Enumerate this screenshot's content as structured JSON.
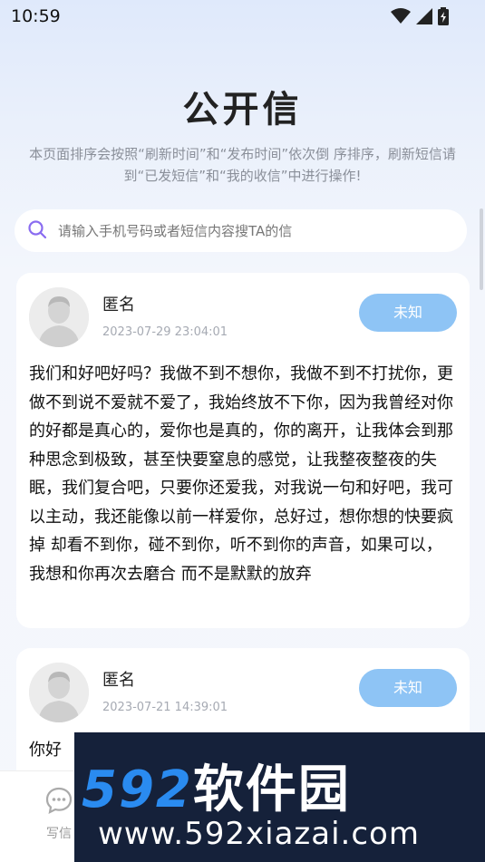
{
  "status_bar": {
    "time": "10:59",
    "icons": [
      "wifi-icon",
      "signal-icon",
      "battery-icon"
    ]
  },
  "header": {
    "title": "公开信",
    "description": "本页面排序会按照“刷新时间”和“发布时间”依次倒 序排序，刷新短信请到“已发短信”和“我的收信”中进行操作!"
  },
  "search": {
    "placeholder": "请输入手机号码或者短信内容搜TA的信",
    "value": ""
  },
  "letters": [
    {
      "author": "匿名",
      "time": "2023-07-29 23:04:01",
      "status": "未知",
      "content": "我们和好吧好吗？我做不到不想你，我做不到不打扰你，更做不到说不爱就不爱了，我始终放不下你，因为我曾经对你的好都是真心的，爱你也是真的，你的离开，让我体会到那种思念到极致，甚至快要窒息的感觉，让我整夜整夜的失眠，我们复合吧，只要你还爱我，对我说一句和好吧，我可以主动，我还能像以前一样爱你，总好过，想你想的快要疯掉 却看不到你，碰不到你，听不到你的声音，如果可以，我想和你再次去磨合 而不是默默的放弃"
    },
    {
      "author": "匿名",
      "time": "2023-07-21 14:39:01",
      "status": "未知",
      "content": "你好"
    }
  ],
  "bottom_nav": {
    "write_label": "写信"
  },
  "watermark": {
    "brand_num": "592",
    "brand_cn": "软件园",
    "url": "www.592xiazai.com"
  },
  "colors": {
    "status_button": "#8ec4f5",
    "search_icon": "#8a6cf0",
    "watermark_bg": "#15213a",
    "watermark_brand": "#2a8bf0"
  }
}
